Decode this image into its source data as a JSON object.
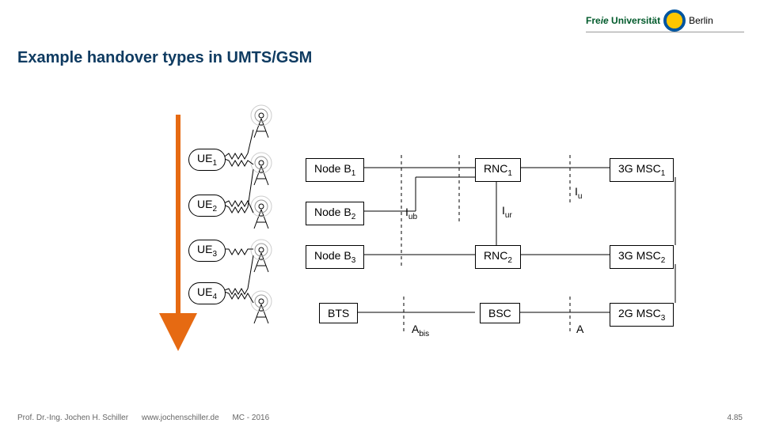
{
  "header": {
    "brand_left": "Freie Universität",
    "brand_right": "Berlin"
  },
  "title": "Example handover types in UMTS/GSM",
  "ue": [
    {
      "label": "UE",
      "sub": "1"
    },
    {
      "label": "UE",
      "sub": "2"
    },
    {
      "label": "UE",
      "sub": "3"
    },
    {
      "label": "UE",
      "sub": "4"
    }
  ],
  "col1": [
    {
      "label": "Node B",
      "sub": "1"
    },
    {
      "label": "Node B",
      "sub": "2"
    },
    {
      "label": "Node B",
      "sub": "3"
    },
    {
      "label": "BTS",
      "sub": ""
    }
  ],
  "col2": [
    {
      "label": "RNC",
      "sub": "1"
    },
    {
      "blank": true
    },
    {
      "label": "RNC",
      "sub": "2"
    },
    {
      "label": "BSC",
      "sub": ""
    }
  ],
  "col3": [
    {
      "label": "3G MSC",
      "sub": "1"
    },
    {
      "blank": true
    },
    {
      "label": "3G MSC",
      "sub": "2"
    },
    {
      "label": "2G MSC",
      "sub": "3"
    }
  ],
  "ifaces": {
    "iu": {
      "label": "I",
      "sub": "u"
    },
    "iub": {
      "label": "I",
      "sub": "ub"
    },
    "iur": {
      "label": "I",
      "sub": "ur"
    },
    "abis": {
      "label": "A",
      "sub": "bis"
    },
    "a": {
      "label": "A",
      "sub": ""
    }
  },
  "footer": {
    "author": "Prof. Dr.-Ing. Jochen H. Schiller",
    "url": "www.jochenschiller.de",
    "course": "MC - 2016",
    "page": "4.85"
  }
}
